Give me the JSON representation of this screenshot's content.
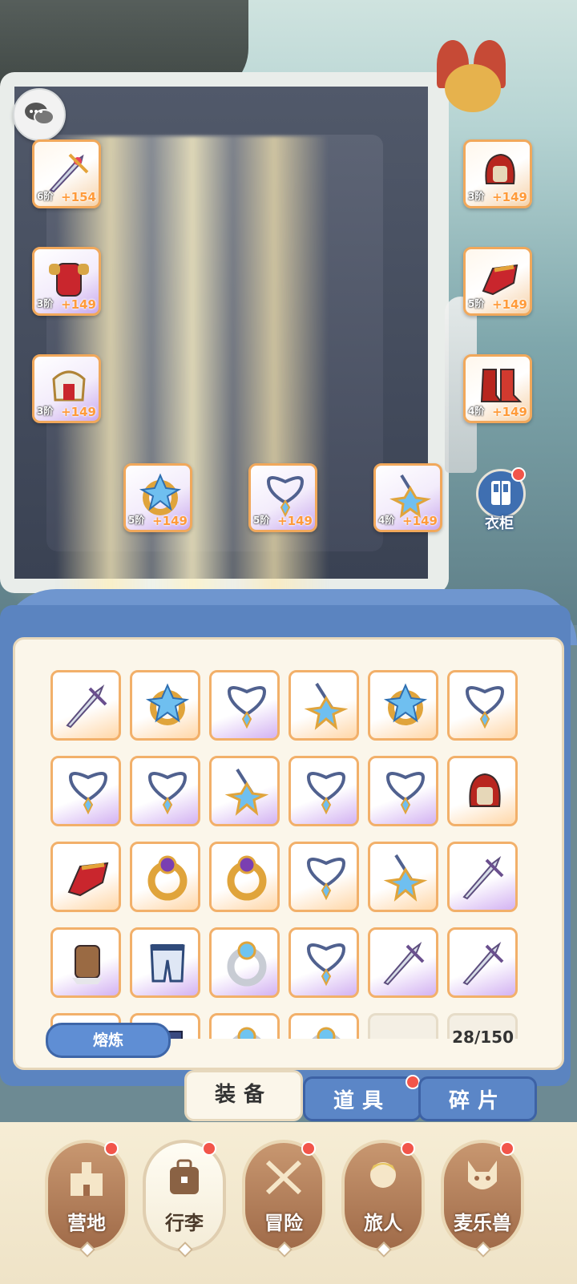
{
  "equipped": {
    "left_slots": [
      {
        "tier": "6阶",
        "bonus": "+154",
        "item": "sword"
      },
      {
        "tier": "3阶",
        "bonus": "+149",
        "item": "armor"
      },
      {
        "tier": "3阶",
        "bonus": "+149",
        "item": "pauldron"
      }
    ],
    "right_slots": [
      {
        "tier": "3阶",
        "bonus": "+149",
        "item": "helmet"
      },
      {
        "tier": "5阶",
        "bonus": "+149",
        "item": "gauntlet"
      },
      {
        "tier": "4阶",
        "bonus": "+149",
        "item": "boots"
      }
    ],
    "bottom_slots": [
      {
        "tier": "5阶",
        "bonus": "+149",
        "item": "ring"
      },
      {
        "tier": "5阶",
        "bonus": "+149",
        "item": "necklace"
      },
      {
        "tier": "4阶",
        "bonus": "+149",
        "item": "amulet"
      }
    ]
  },
  "wardrobe": {
    "label": "衣柜",
    "icon": "wardrobe-icon"
  },
  "inventory": {
    "smelt_label": "熔炼",
    "count": "28/150",
    "items": [
      {
        "item": "sword",
        "rarity": "orange"
      },
      {
        "item": "ring",
        "rarity": "orange"
      },
      {
        "item": "necklace",
        "rarity": "purple"
      },
      {
        "item": "amulet",
        "rarity": "orange"
      },
      {
        "item": "ring",
        "rarity": "orange"
      },
      {
        "item": "necklace",
        "rarity": "orange"
      },
      {
        "item": "necklace",
        "rarity": "purple"
      },
      {
        "item": "necklace",
        "rarity": "purple"
      },
      {
        "item": "amulet",
        "rarity": "purple"
      },
      {
        "item": "necklace",
        "rarity": "purple"
      },
      {
        "item": "necklace",
        "rarity": "purple"
      },
      {
        "item": "helmet",
        "rarity": "orange"
      },
      {
        "item": "gauntlet",
        "rarity": "orange"
      },
      {
        "item": "purple-ring",
        "rarity": "orange"
      },
      {
        "item": "purple-ring",
        "rarity": "orange"
      },
      {
        "item": "necklace",
        "rarity": "orange"
      },
      {
        "item": "amulet",
        "rarity": "orange"
      },
      {
        "item": "sword",
        "rarity": "purple"
      },
      {
        "item": "bracer",
        "rarity": "purple"
      },
      {
        "item": "pants",
        "rarity": "purple"
      },
      {
        "item": "silver-ring",
        "rarity": "purple"
      },
      {
        "item": "necklace",
        "rarity": "purple"
      },
      {
        "item": "sword",
        "rarity": "purple"
      },
      {
        "item": "sword",
        "rarity": "purple"
      },
      {
        "item": "bracer",
        "rarity": "purple"
      },
      {
        "item": "boots",
        "rarity": "purple"
      },
      {
        "item": "silver-ring",
        "rarity": "purple"
      },
      {
        "item": "silver-ring",
        "rarity": "purple"
      },
      {
        "item": "empty",
        "rarity": "empty"
      },
      {
        "item": "empty",
        "rarity": "empty"
      }
    ]
  },
  "tabs": [
    {
      "label": "装备",
      "active": true
    },
    {
      "label": "道具",
      "active": false,
      "badge": true
    },
    {
      "label": "碎片",
      "active": false
    }
  ],
  "nav": [
    {
      "label": "营地",
      "icon": "castle-icon",
      "badge": true
    },
    {
      "label": "行李",
      "icon": "bag-icon",
      "badge": true,
      "active": true
    },
    {
      "label": "冒险",
      "icon": "crossed-swords-icon",
      "badge": true
    },
    {
      "label": "旅人",
      "icon": "traveler-icon",
      "badge": true
    },
    {
      "label": "麦乐兽",
      "icon": "creature-icon",
      "badge": true
    }
  ],
  "colors": {
    "accent_blue": "#5b86c7",
    "badge_red": "#f2554a",
    "orange_border": "#f1a85b",
    "purple_fill": "#c9a9ee"
  }
}
